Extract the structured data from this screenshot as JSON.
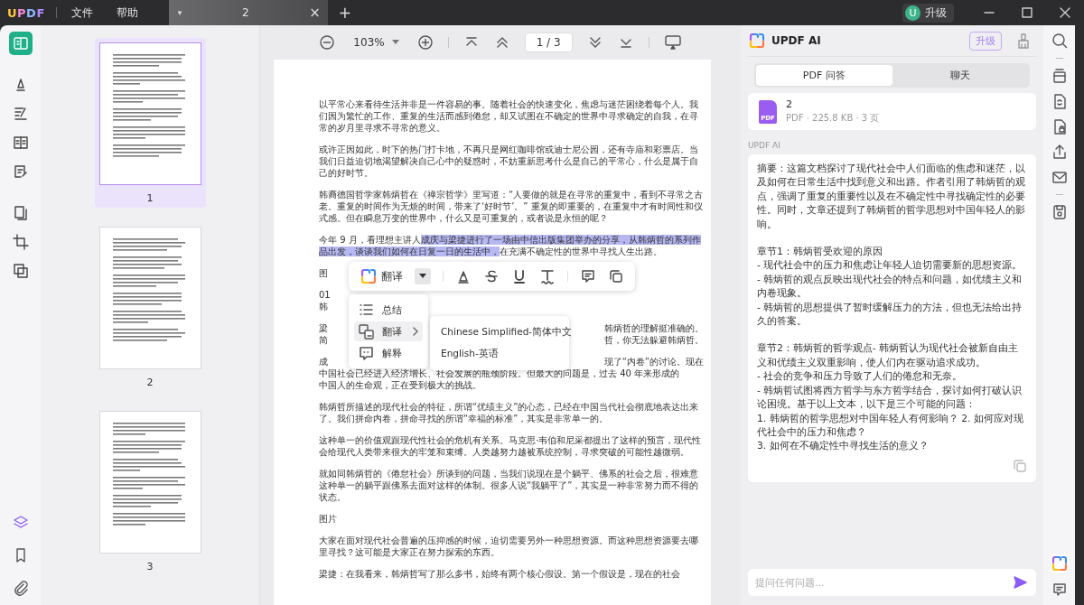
{
  "title_bar": {
    "logo": "UPDF",
    "menus": [
      "文件",
      "帮助"
    ],
    "tab": {
      "caret": "▾",
      "title": "2",
      "close": "×"
    },
    "new_tab": "+",
    "avatar": "U",
    "upgrade": "升级"
  },
  "left_toolbar": [
    {
      "selected": true
    },
    {
      "selected": false
    },
    {
      "selected": false
    },
    {
      "selected": false
    },
    {
      "selected": false
    },
    {
      "selected": false
    },
    {
      "selected": false
    },
    {
      "selected": false
    }
  ],
  "thumbnails": [
    {
      "label": "1",
      "selected": true
    },
    {
      "label": "2",
      "selected": false
    },
    {
      "label": "3",
      "selected": false
    }
  ],
  "doc_toolbar": {
    "zoom": "103%",
    "page": "1 / 3"
  },
  "document": {
    "paragraphs": [
      {
        "kind": "text",
        "text": "以平常心来看待生活并非是一件容易的事。随着社会的快速变化，焦虑与迷茫困绕着每个人。我们因为繁忙的工作、重复的生活而感到倦怠，却又试图在不确定的世界中寻求确定的自我，在寻常的岁月里寻求不寻常的意义。"
      },
      {
        "kind": "text",
        "text": "或许正因如此，时下的热门打卡地，不再只是网红咖啡馆或迪士尼公园，还有寺庙和彩票店。当我们日益迫切地渴望解决自己心中的疑惑时，不妨重新思考什么是自己的平常心，什么是属于自己的好时节。"
      },
      {
        "kind": "text",
        "text": "韩裔德国哲学家韩炳哲在《禅宗哲学》里写道：“人要做的就是在寻常的重复中，看到不寻常之古老。重复的时间作为无烦的时间，带来了‘好时节’。” 重复的即重要的，在重复中才有时间性和仪式感。但在瞬息万变的世界中，什么又是可重复的，或者说是永恒的呢？"
      },
      {
        "kind": "segments",
        "segments": [
          {
            "text": "今年 9 月，看理想主讲人",
            "highlighted": false
          },
          {
            "text": "成庆与梁捷进行了一场由中信出版集团举办的分享，从韩炳哲的系列作品出发，谈谈我们如何在日复一日的生活中，",
            "highlighted": true
          },
          {
            "text": "在充满不确定性的世界中寻找人生出路。",
            "highlighted": false
          }
        ]
      },
      {
        "kind": "cut",
        "lines": [
          {
            "start": "图"
          }
        ]
      },
      {
        "kind": "cut",
        "lines": [
          {
            "start": "01"
          },
          {
            "start": "韩"
          }
        ]
      },
      {
        "kind": "cut",
        "lines": [
          {
            "start": "梁",
            "end": "韩炳哲的理解挺准确的。"
          },
          {
            "start": "简",
            "end": "哲，你无法躲避韩炳哲。"
          }
        ]
      },
      {
        "kind": "cut",
        "lines": [
          {
            "start": "成",
            "end": "现了“内卷”的讨论。现在"
          },
          {
            "start": "中国社会已经进入经济增长、社会发展的瓶颈阶段。但最大的问题是，过去 40 年来形成的"
          },
          {
            "start": "中国人的生命观，正在受到极大的挑战。"
          }
        ]
      },
      {
        "kind": "text",
        "text": "韩炳哲所描述的现代社会的特征，所谓“优绩主义”的心态，已经在中国当代社会彻底地表达出来了。我们拼命内卷，拼命寻找的所谓“幸福的标准”，其实是非常单一的。"
      },
      {
        "kind": "text",
        "text": "这种单一的价值观跟现代性社会的危机有关系。马克思·韦伯和尼采都提出了这样的预言，现代性会给现代人类带来很大的牢笼和束缚。人类越努力越被系统控制，寻求突破的可能性越微弱。"
      },
      {
        "kind": "text",
        "text": "就如同韩炳哲的《倦怠社会》所谈到的问题，当我们说现在是个躺平、佛系的社会之后，很难意这种单一的躺平跟佛系去面对这样的体制。很多人说“我躺平了”，其实是一种非常努力而不得的状态。"
      },
      {
        "kind": "text",
        "text": "图片"
      },
      {
        "kind": "text",
        "text": "大家在面对现代社会普遍的压抑感的时候，迫切需要另外一种思想资源。而这种思想资源要去哪里寻找？这可能是大家正在努力探索的东西。"
      },
      {
        "kind": "text",
        "text": "梁捷：在我看来，韩炳哲写了那么多书，始终有两个核心假设。第一个假设是，现在的社会"
      }
    ]
  },
  "selection_toolbar": {
    "action": "翻译"
  },
  "context_menu": [
    {
      "kind": "list",
      "label": "总结",
      "selected": false
    },
    {
      "kind": "translate",
      "label": "翻译",
      "selected": true
    },
    {
      "kind": "explain",
      "label": "解释",
      "selected": false
    }
  ],
  "submenu": [
    "Chinese Simplified-简体中文",
    "English-英语"
  ],
  "ai_panel": {
    "title": "UPDF AI",
    "upgrade": "升级",
    "tabs": [
      {
        "label": "PDF 问答",
        "selected": true
      },
      {
        "label": "聊天",
        "selected": false
      }
    ],
    "file": {
      "name": "2",
      "meta": "PDF · 225.8 KB · 3 页",
      "badge": "PDF"
    },
    "sender": "UPDF AI",
    "message": [
      [
        "摘要：这篇文档探讨了现代社会中人们面临的焦虑和迷茫，以及如何在日常生活中找到意义和出路。作者引用了韩炳哲的观点，强调了重复的重要性以及在不确定性中寻找确定性的必要性。同时，文章还提到了韩炳哲的哲学思想对中国年轻人的影响。"
      ],
      [
        "章节1：韩炳哲受欢迎的原因",
        "- 现代社会中的压力和焦虑让年轻人迫切需要新的思想资源。",
        "- 韩炳哲的观点反映出现代社会的特点和问题，如优绩主义和内卷现象。",
        "- 韩炳哲的思想提供了暂时缓解压力的方法，但也无法给出持久的答案。"
      ],
      [
        "章节2：韩炳哲的哲学观点- 韩炳哲认为现代社会被新自由主义和优绩主义双重影响，使人们内在驱动追求成功。",
        "- 社会的竞争和压力导致了人们的倦怠和无奈。",
        "- 韩炳哲试图将西方哲学与东方哲学结合，探讨如何打破认识论困境。基于以上文本，以下是三个可能的问题：",
        "1. 韩炳哲的哲学思想对中国年轻人有何影响？ 2. 如何应对现代社会中的压力和焦虑？",
        "3. 如何在不确定性中寻找生活的意义？"
      ]
    ],
    "input": {
      "placeholder": "提问任何问题..."
    }
  }
}
